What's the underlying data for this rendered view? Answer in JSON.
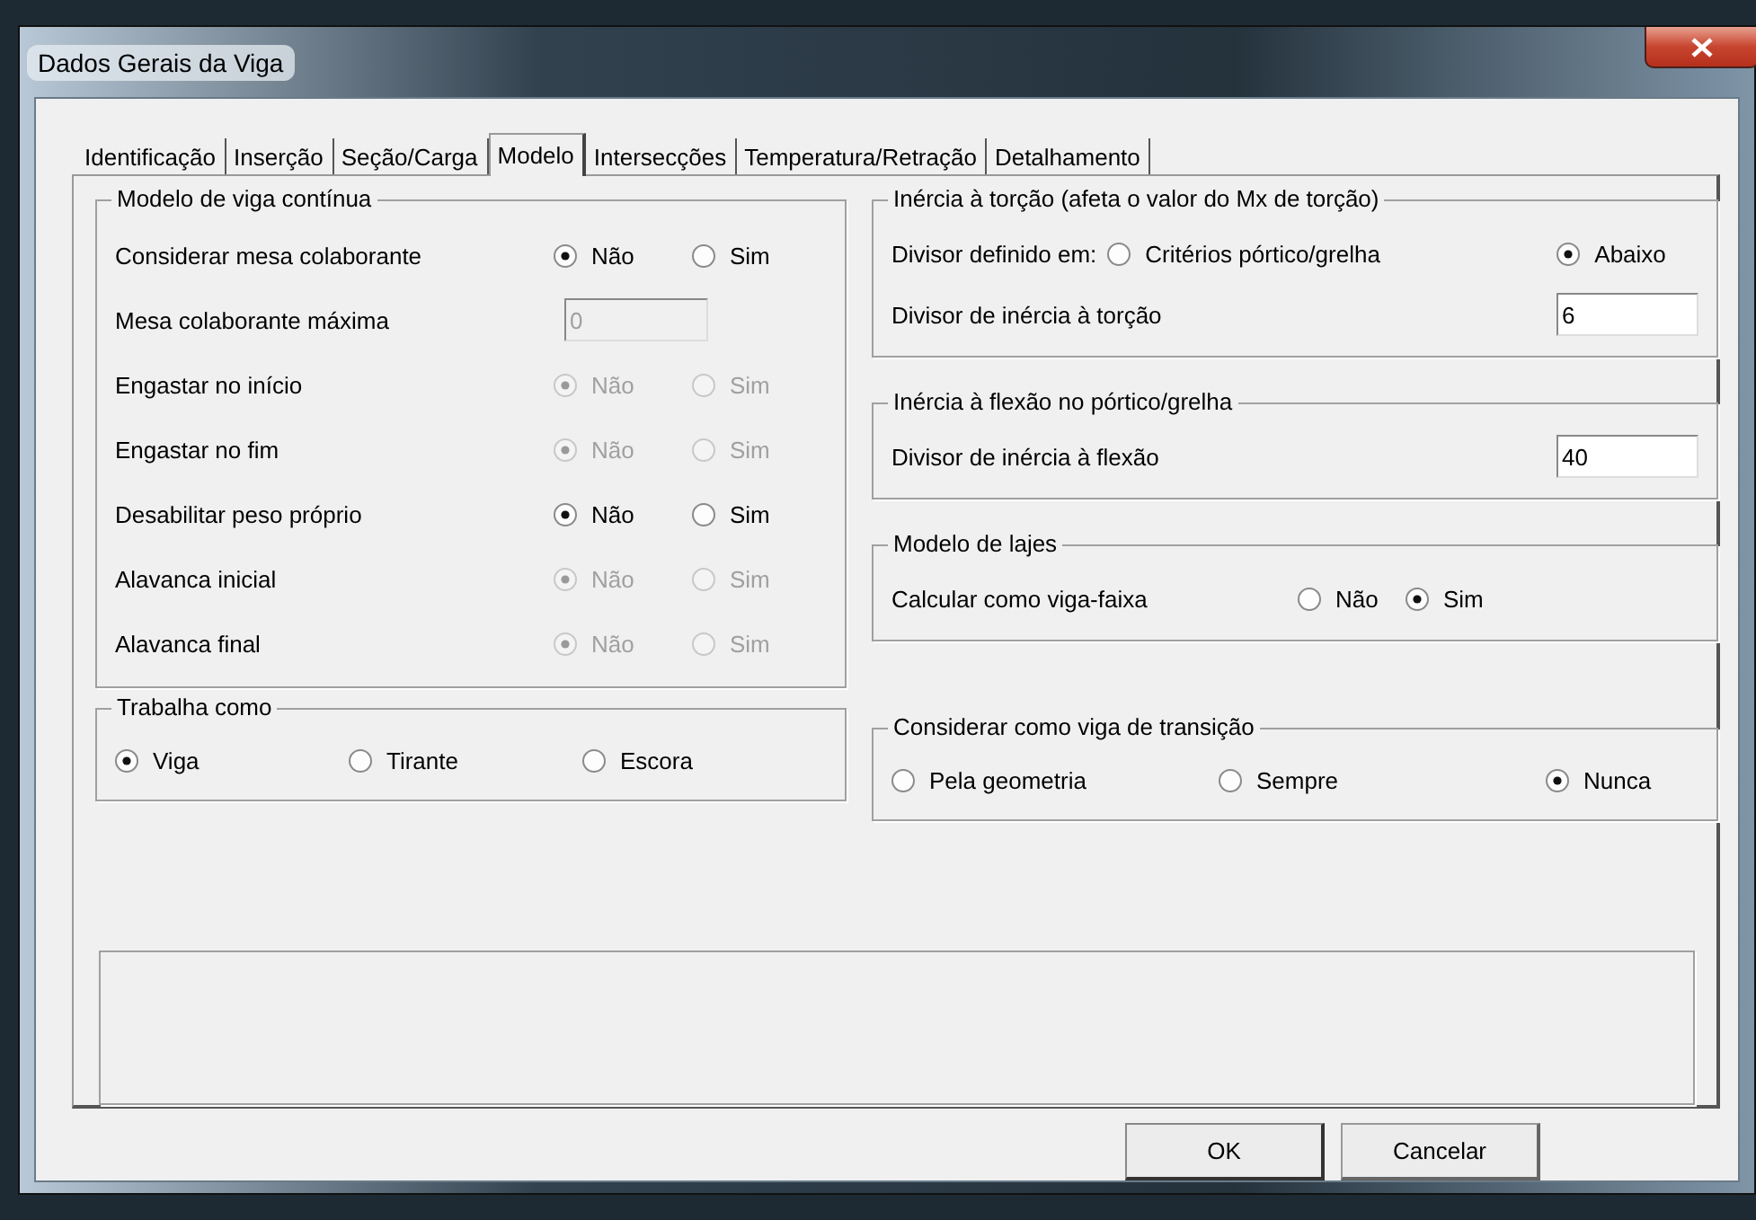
{
  "window": {
    "title": "Dados Gerais da Viga"
  },
  "tabs": [
    {
      "label": "Identificação",
      "selected": false
    },
    {
      "label": "Inserção",
      "selected": false
    },
    {
      "label": "Seção/Carga",
      "selected": false
    },
    {
      "label": "Modelo",
      "selected": true
    },
    {
      "label": "Intersecções",
      "selected": false
    },
    {
      "label": "Temperatura/Retração",
      "selected": false
    },
    {
      "label": "Detalhamento",
      "selected": false
    }
  ],
  "left_groups": [
    {
      "title": "Modelo de viga contínua",
      "rows": [
        {
          "kind": "radio",
          "label": "Considerar mesa colaborante",
          "disabled": false,
          "options": [
            {
              "label": "Não",
              "selected": true
            },
            {
              "label": "Sim",
              "selected": false
            }
          ]
        },
        {
          "kind": "field",
          "label": "Mesa colaborante máxima",
          "disabled": true,
          "value": "0"
        },
        {
          "kind": "radio",
          "label": "Engastar no início",
          "disabled": true,
          "options": [
            {
              "label": "Não",
              "selected": true
            },
            {
              "label": "Sim",
              "selected": false
            }
          ]
        },
        {
          "kind": "radio",
          "label": "Engastar no fim",
          "disabled": true,
          "options": [
            {
              "label": "Não",
              "selected": true
            },
            {
              "label": "Sim",
              "selected": false
            }
          ]
        },
        {
          "kind": "radio",
          "label": "Desabilitar peso próprio",
          "disabled": false,
          "options": [
            {
              "label": "Não",
              "selected": true
            },
            {
              "label": "Sim",
              "selected": false
            }
          ]
        },
        {
          "kind": "radio",
          "label": "Alavanca inicial",
          "disabled": true,
          "options": [
            {
              "label": "Não",
              "selected": true
            },
            {
              "label": "Sim",
              "selected": false
            }
          ]
        },
        {
          "kind": "radio",
          "label": "Alavanca final",
          "disabled": true,
          "options": [
            {
              "label": "Não",
              "selected": true
            },
            {
              "label": "Sim",
              "selected": false
            }
          ]
        }
      ]
    },
    {
      "title": "Trabalha como",
      "rows": [
        {
          "kind": "radio",
          "disabled": false,
          "options": [
            {
              "label": "Viga",
              "selected": true
            },
            {
              "label": "Tirante",
              "selected": false
            },
            {
              "label": "Escora",
              "selected": false
            }
          ]
        }
      ]
    }
  ],
  "right_groups": [
    {
      "title": "Inércia à torção (afeta o valor do Mx de torção)",
      "rows": [
        {
          "kind": "radio",
          "label": "Divisor definido em:",
          "disabled": false,
          "options": [
            {
              "label": "Critérios pórtico/grelha",
              "selected": false
            },
            {
              "label": "Abaixo",
              "selected": true
            }
          ]
        },
        {
          "kind": "field",
          "label": "Divisor de inércia à torção",
          "disabled": false,
          "value": "6"
        }
      ]
    },
    {
      "title": "Inércia à flexão no pórtico/grelha",
      "rows": [
        {
          "kind": "field",
          "label": "Divisor de inércia à flexão",
          "disabled": false,
          "value": "40"
        }
      ]
    },
    {
      "title": "Modelo de lajes",
      "rows": [
        {
          "kind": "radio",
          "label": "Calcular como viga-faixa",
          "disabled": false,
          "options": [
            {
              "label": "Não",
              "selected": false
            },
            {
              "label": "Sim",
              "selected": true
            }
          ]
        }
      ]
    },
    {
      "title": "Considerar como viga de transição",
      "rows": [
        {
          "kind": "radio",
          "disabled": false,
          "options": [
            {
              "label": "Pela geometria",
              "selected": false
            },
            {
              "label": "Sempre",
              "selected": false
            },
            {
              "label": "Nunca",
              "selected": true
            }
          ]
        }
      ]
    }
  ],
  "buttons": [
    {
      "label": "OK",
      "default": true
    },
    {
      "label": "Cancelar",
      "default": false
    }
  ]
}
